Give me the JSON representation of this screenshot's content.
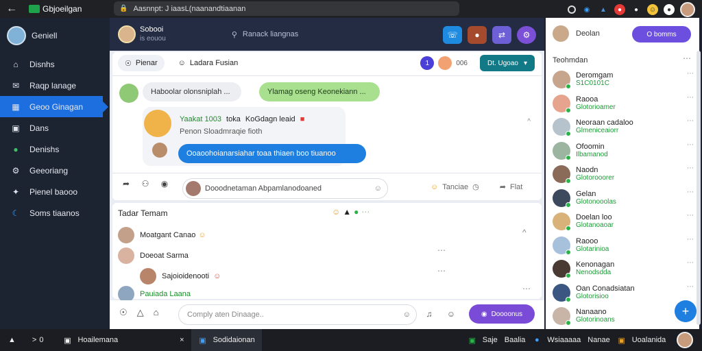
{
  "topbar": {
    "back_icon": "arrow-left-icon",
    "title": "Gbjoeilgan",
    "url": "Aasnnpt: J iaasL(naanandtiaanan",
    "icons": [
      "refresh-icon",
      "extension-icon",
      "shield-icon",
      "tag-icon",
      "bell-icon",
      "emoji-icon",
      "badge-icon"
    ]
  },
  "sidebar": {
    "profile_name": "Geniell",
    "items": [
      {
        "label": "Disnhs",
        "icon": "home-icon"
      },
      {
        "label": "Raqp lanage",
        "icon": "mail-icon"
      },
      {
        "label": "Geoo Ginagan",
        "icon": "chat-icon"
      },
      {
        "label": "Dans",
        "icon": "bookmark-icon"
      },
      {
        "label": "Denishs",
        "icon": "globe-icon"
      },
      {
        "label": "Geeoriang",
        "icon": "group-icon"
      },
      {
        "label": "Pienel baooo",
        "icon": "settings-icon"
      },
      {
        "label": "Soms tiaanos",
        "icon": "moon-icon"
      }
    ]
  },
  "chat_header": {
    "name": "Sobooi",
    "sub": "is eouou",
    "search": "Ranack liangnas"
  },
  "tabs": [
    {
      "label": "Pienar",
      "icon": "compass-icon"
    },
    {
      "label": "Ladara Fusian",
      "icon": "smile-icon"
    }
  ],
  "tab_count": "006",
  "update_button": "Dt. Ugoao",
  "messages": {
    "bubble1": "Haboolar olonsniplah ...",
    "bubble2": "Ylamag oseng Keonekiann ...",
    "group_line1_green": "Yaakat 1003",
    "group_line1_mid": "toka",
    "group_line1_dark": "KoGdagn leaid",
    "group_line2": "Penon Sloadmraqie fioth",
    "bubble3": "Ooaoohoianarsiahar toaa thiaen boo tiuanoo"
  },
  "composer": {
    "placeholder": "Dooodnetaman Abpamlanodoaned",
    "meta_label": "Tanciae",
    "post_label": "Flat"
  },
  "card2": {
    "title": "Tadar Temam",
    "rows": [
      {
        "name": "Moatgant Canao"
      },
      {
        "name": "Doeoat Sarma"
      },
      {
        "name": "Sajoioidenooti"
      },
      {
        "name": "Pauiada Laana"
      }
    ]
  },
  "footer": {
    "placeholder": "Comply aten Dinaage..",
    "send_button": "Doooonus"
  },
  "rpanel": {
    "name": "Deolan",
    "button": "O bomms",
    "section_title": "Teohmdan",
    "contacts": [
      {
        "name": "Deromgam",
        "status": "S1C0101C"
      },
      {
        "name": "Raooa",
        "status": "Glotorioamer"
      },
      {
        "name": "Neoraan cadaloo",
        "status": "Glmeniceaiorr"
      },
      {
        "name": "Ofoomin",
        "status": "Ilbamanod"
      },
      {
        "name": "Naodn",
        "status": "Glotorooorer"
      },
      {
        "name": "Gelan",
        "status": "Glotonooolas"
      },
      {
        "name": "Doelan loo",
        "status": "Glotanoaoar"
      },
      {
        "name": "Raooo",
        "status": "Glotarinioa"
      },
      {
        "name": "Kenonagan",
        "status": "Nenodsdda"
      },
      {
        "name": "Oan Conadsiatan",
        "status": "Glotorisioo"
      },
      {
        "name": "Nanaano",
        "status": "Glotorinoans"
      }
    ]
  },
  "taskbar": {
    "items": [
      "Hoailemana",
      "Sodidaionan",
      "Saje",
      "Baalia",
      "Wsiaaaaa",
      "Nanae",
      "Uoalanida"
    ],
    "count": "0"
  }
}
